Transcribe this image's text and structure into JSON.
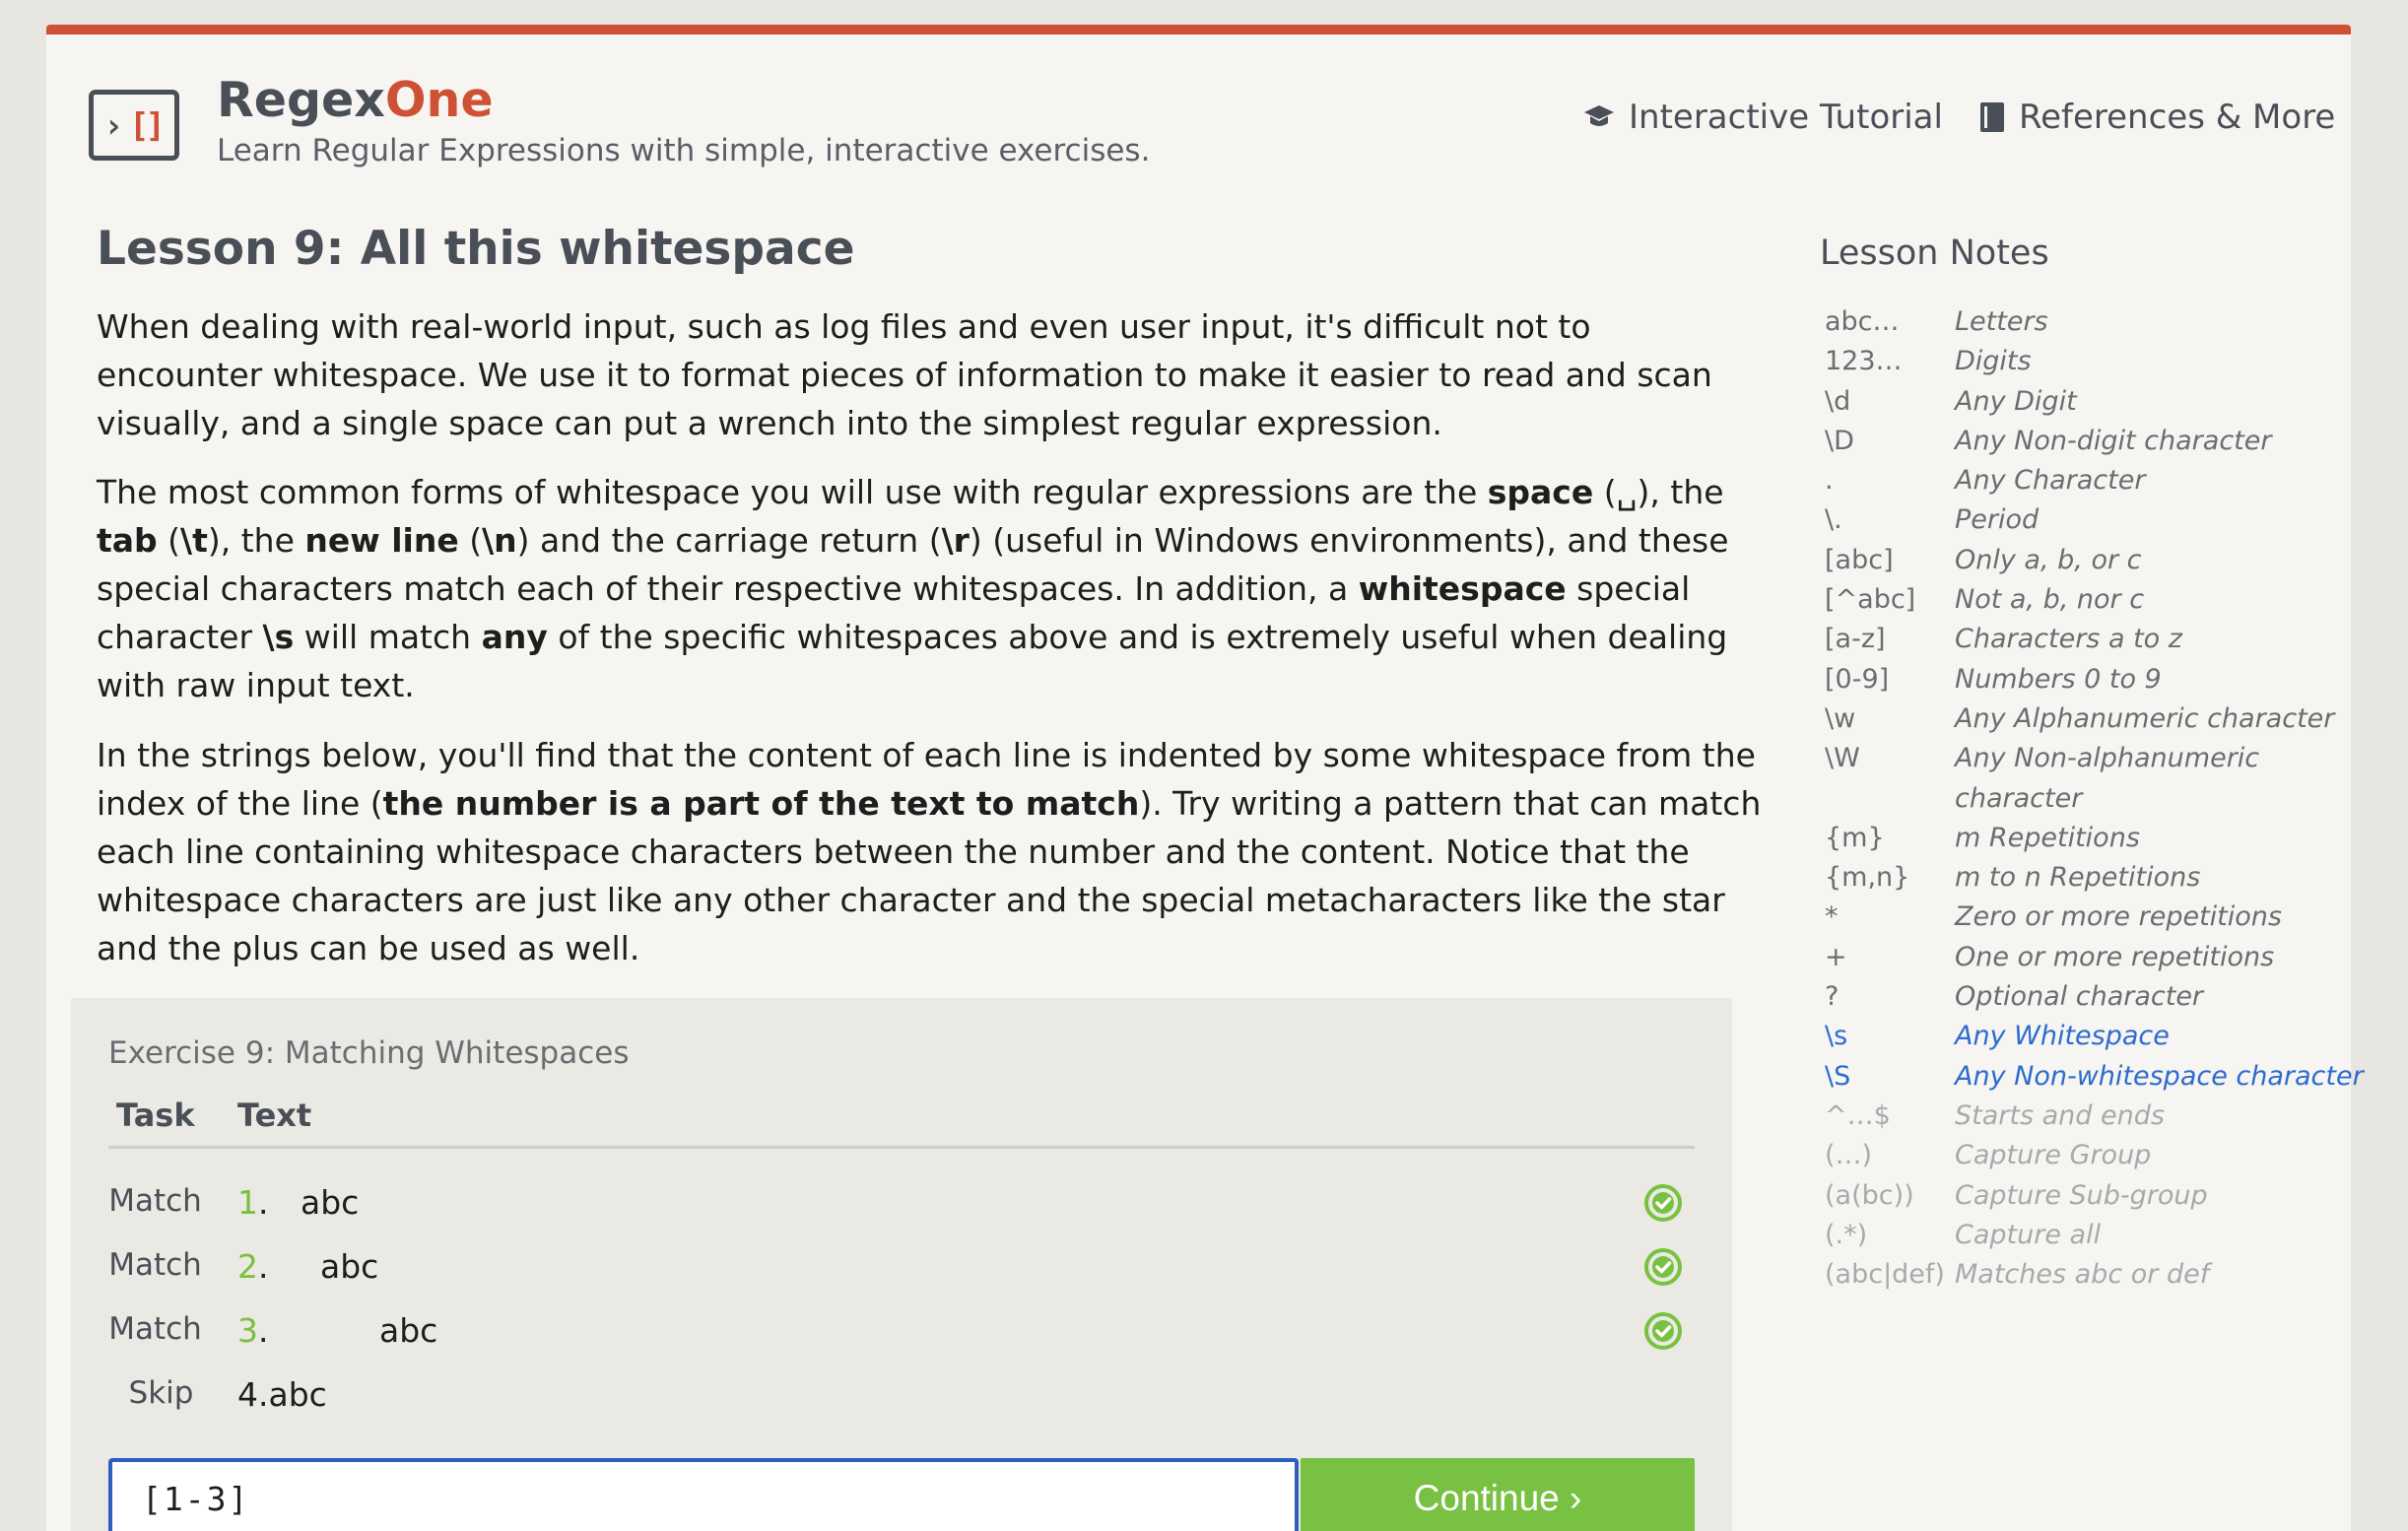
{
  "header": {
    "brand_main": "Regex",
    "brand_accent": "One",
    "tagline": "Learn Regular Expressions with simple, interactive exercises.",
    "nav": {
      "tutorial": "Interactive Tutorial",
      "references": "References & More"
    }
  },
  "lesson": {
    "title": "Lesson 9: All this whitespace",
    "p1": "When dealing with real-world input, such as log files and even user input, it's difficult not to encounter whitespace. We use it to format pieces of information to make it easier to read and scan visually, and a single space can put a wrench into the simplest regular expression.",
    "p2": {
      "t1": "The most common forms of whitespace you will use with regular expressions are the ",
      "b1": "space",
      "t2": " (␣), the ",
      "b2": "tab",
      "t3": " (",
      "b3": "\\t",
      "t4": "), the ",
      "b4": "new line",
      "t5": " (",
      "b5": "\\n",
      "t6": ") and the carriage return (",
      "b6": "\\r",
      "t7": ") (useful in Windows environments), and these special characters match each of their respective whitespaces. In addition, a ",
      "b7": "whitespace",
      "t8": " special character ",
      "b8": "\\s",
      "t9": " will match ",
      "b9": "any",
      "t10": " of the specific whitespaces above and is extremely useful when dealing with raw input text."
    },
    "p3": {
      "t1": "In the strings below, you'll find that the content of each line is indented by some whitespace from the index of the line (",
      "b1": "the number is a part of the text to match",
      "t2": "). Try writing a pattern that can match each line containing whitespace characters between the number and the content. Notice that the whitespace characters are just like any other character and the special metacharacters like the star and the plus can be used as well."
    }
  },
  "exercise": {
    "title": "Exercise 9: Matching Whitespaces",
    "col_task": "Task",
    "col_text": "Text",
    "rows": [
      {
        "task": "Match",
        "index": "1",
        "text": "abc"
      },
      {
        "task": "Match",
        "index": "2",
        "text": "abc"
      },
      {
        "task": "Match",
        "index": "3",
        "text": "abc"
      },
      {
        "task": "Skip",
        "index": "",
        "text": "4.abc"
      }
    ],
    "dot": ".",
    "input_value": "[1-3]",
    "continue_label": "Continue ›"
  },
  "notes": {
    "title": "Lesson Notes",
    "items": [
      {
        "k": "abc…",
        "v": "Letters"
      },
      {
        "k": "123…",
        "v": "Digits"
      },
      {
        "k": "\\d",
        "v": "Any Digit"
      },
      {
        "k": "\\D",
        "v": "Any Non-digit character"
      },
      {
        "k": ".",
        "v": "Any Character"
      },
      {
        "k": "\\.",
        "v": "Period"
      },
      {
        "k": "[abc]",
        "v": "Only a, b, or c"
      },
      {
        "k": "[^abc]",
        "v": "Not a, b, nor c"
      },
      {
        "k": "[a-z]",
        "v": "Characters a to z"
      },
      {
        "k": "[0-9]",
        "v": "Numbers 0 to 9"
      },
      {
        "k": "\\w",
        "v": "Any Alphanumeric character"
      },
      {
        "k": "\\W",
        "v": "Any Non-alphanumeric"
      },
      {
        "k": "",
        "v": "character"
      },
      {
        "k": "{m}",
        "v": "m Repetitions"
      },
      {
        "k": "{m,n}",
        "v": "m to n Repetitions"
      },
      {
        "k": "*",
        "v": "Zero or more repetitions"
      },
      {
        "k": "+",
        "v": "One or more repetitions"
      },
      {
        "k": "?",
        "v": "Optional character"
      },
      {
        "k": "\\s",
        "v": "Any Whitespace"
      },
      {
        "k": "\\S",
        "v": "Any Non-whitespace character"
      },
      {
        "k": "^…$",
        "v": "Starts and ends"
      },
      {
        "k": "(…)",
        "v": "Capture Group"
      },
      {
        "k": "(a(bc))",
        "v": "Capture Sub-group"
      },
      {
        "k": "(.*)",
        "v": "Capture all"
      },
      {
        "k": "(abc|def)",
        "v": "Matches abc or def"
      }
    ]
  },
  "colors": {
    "accent": "#cf5135",
    "success": "#78c142",
    "link_active": "#2d6bd0",
    "input_border": "#2d5fc1"
  },
  "icons": {
    "logo": "regexone-logo-icon",
    "tutorial": "graduation-cap-icon",
    "references": "book-icon",
    "check": "check-circle-icon"
  }
}
